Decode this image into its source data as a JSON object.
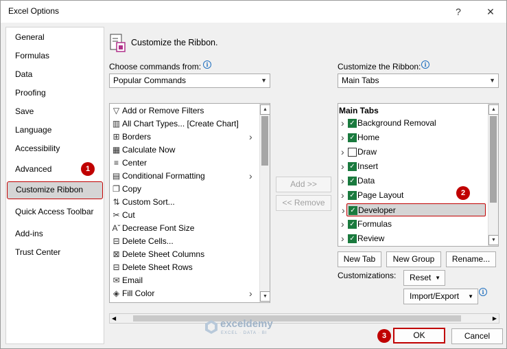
{
  "window": {
    "title": "Excel Options",
    "help_glyph": "?",
    "close_glyph": "✕"
  },
  "nav": {
    "items": [
      {
        "label": "General"
      },
      {
        "label": "Formulas"
      },
      {
        "label": "Data"
      },
      {
        "label": "Proofing"
      },
      {
        "label": "Save"
      },
      {
        "label": "Language"
      },
      {
        "label": "Accessibility"
      },
      {
        "label": "Advanced"
      },
      {
        "label": "Customize Ribbon"
      },
      {
        "label": "Quick Access Toolbar"
      },
      {
        "label": "Add-ins"
      },
      {
        "label": "Trust Center"
      }
    ],
    "selected": "Customize Ribbon"
  },
  "badges": {
    "one": "1",
    "two": "2",
    "three": "3"
  },
  "heading": "Customize the Ribbon.",
  "choose": {
    "label": "Choose commands from:",
    "value": "Popular Commands"
  },
  "customize": {
    "label": "Customize the Ribbon:",
    "value": "Main Tabs"
  },
  "commands": [
    {
      "label": "Add or Remove Filters",
      "icon": "filter-icon",
      "glyph": "▽"
    },
    {
      "label": "All Chart Types... [Create Chart]",
      "icon": "chart-icon",
      "glyph": "▥"
    },
    {
      "label": "Borders",
      "icon": "borders-icon",
      "glyph": "⊞",
      "submenu": true
    },
    {
      "label": "Calculate Now",
      "icon": "calculator-icon",
      "glyph": "▦"
    },
    {
      "label": "Center",
      "icon": "center-align-icon",
      "glyph": "≡"
    },
    {
      "label": "Conditional Formatting",
      "icon": "conditional-formatting-icon",
      "glyph": "▤",
      "submenu": true
    },
    {
      "label": "Copy",
      "icon": "copy-icon",
      "glyph": "❐"
    },
    {
      "label": "Custom Sort...",
      "icon": "sort-icon",
      "glyph": "⇅"
    },
    {
      "label": "Cut",
      "icon": "scissors-icon",
      "glyph": "✂"
    },
    {
      "label": "Decrease Font Size",
      "icon": "decrease-font-icon",
      "glyph": "Aˇ"
    },
    {
      "label": "Delete Cells...",
      "icon": "delete-cells-icon",
      "glyph": "⊟"
    },
    {
      "label": "Delete Sheet Columns",
      "icon": "delete-columns-icon",
      "glyph": "⊠"
    },
    {
      "label": "Delete Sheet Rows",
      "icon": "delete-rows-icon",
      "glyph": "⊟"
    },
    {
      "label": "Email",
      "icon": "email-icon",
      "glyph": "✉"
    },
    {
      "label": "Fill Color",
      "icon": "fill-color-icon",
      "glyph": "◈",
      "submenu": true
    }
  ],
  "transfer": {
    "add": "Add >>",
    "remove": "<< Remove"
  },
  "tabs_tree": {
    "header": "Main Tabs",
    "items": [
      {
        "label": "Background Removal",
        "checked": true
      },
      {
        "label": "Home",
        "checked": true
      },
      {
        "label": "Draw",
        "checked": false
      },
      {
        "label": "Insert",
        "checked": true
      },
      {
        "label": "Data",
        "checked": true
      },
      {
        "label": "Page Layout",
        "checked": true
      },
      {
        "label": "Developer",
        "checked": true
      },
      {
        "label": "Formulas",
        "checked": true
      },
      {
        "label": "Review",
        "checked": true
      }
    ],
    "selected": "Developer"
  },
  "buttons": {
    "new_tab": "New Tab",
    "new_group": "New Group",
    "rename": "Rename...",
    "customizations_label": "Customizations:",
    "reset": "Reset",
    "import_export": "Import/Export",
    "ok": "OK",
    "cancel": "Cancel"
  },
  "watermark": {
    "brand": "exceldemy",
    "tagline": "EXCEL · DATA · BI"
  },
  "colors": {
    "accent_red": "#c00000",
    "check_green": "#1a7a3e"
  }
}
